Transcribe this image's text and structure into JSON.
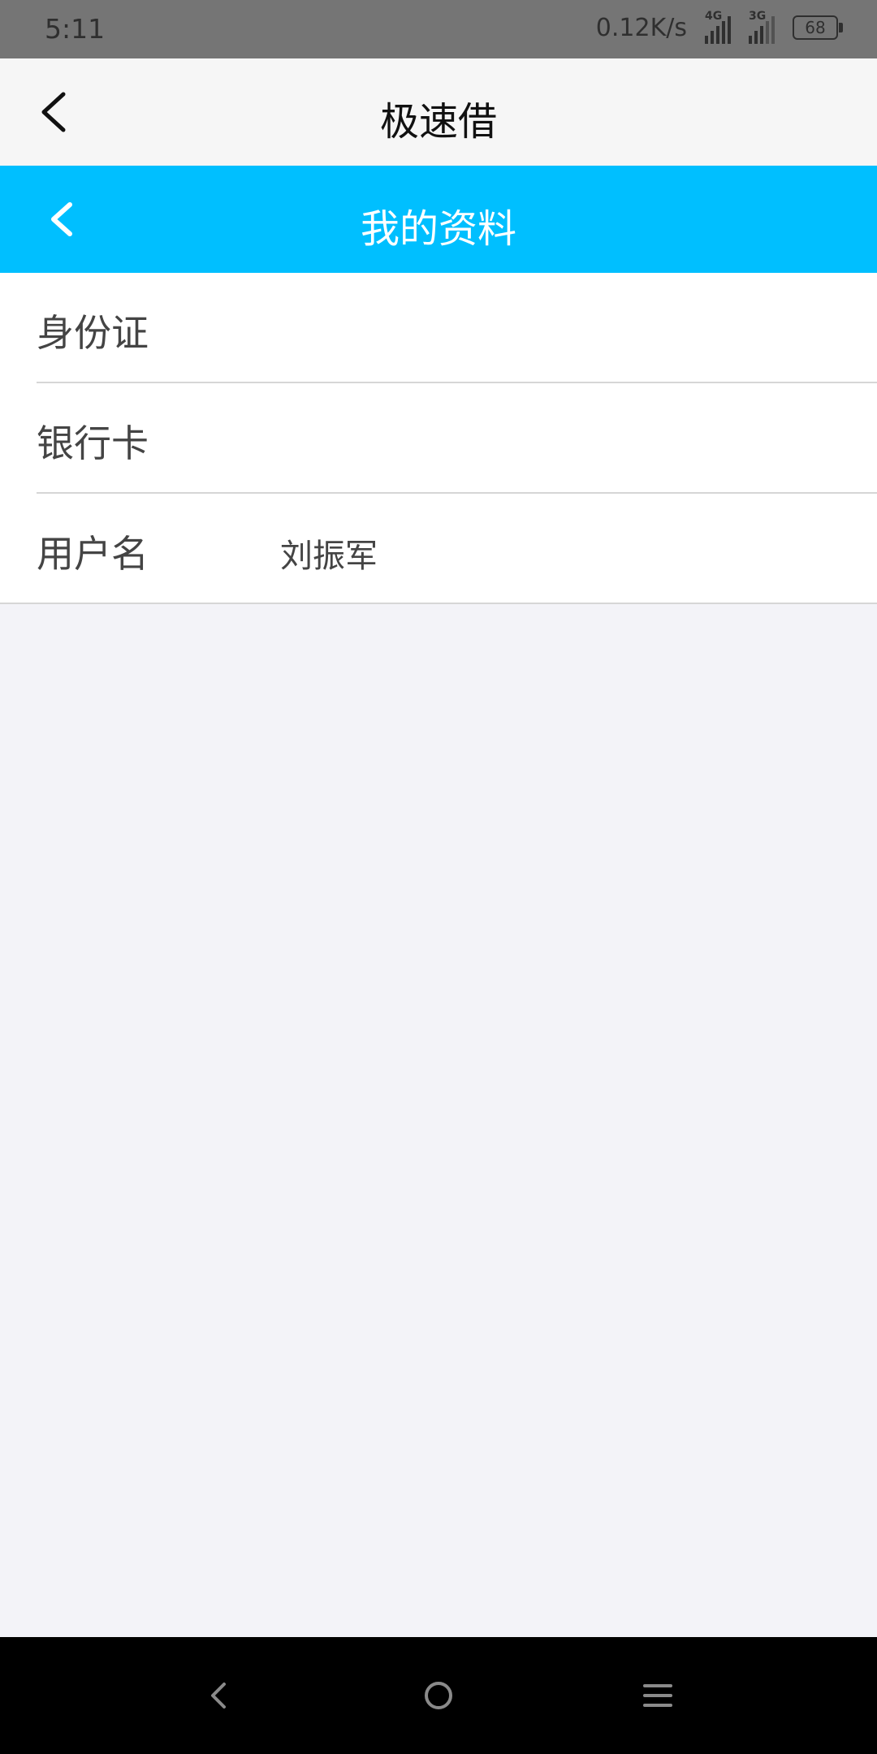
{
  "status_bar": {
    "time": "5:11",
    "net_speed": "0.12K/s",
    "signal1_label": "4G",
    "signal2_label": "3G",
    "battery": "68"
  },
  "app_bar": {
    "title": "极速借",
    "back_icon": "chevron-left-icon"
  },
  "sub_bar": {
    "title": "我的资料",
    "back_icon": "chevron-left-icon",
    "color": "#00bfff"
  },
  "profile": {
    "rows": [
      {
        "label": "身份证",
        "value": ""
      },
      {
        "label": "银行卡",
        "value": ""
      },
      {
        "label": "用户名",
        "value": "刘振军"
      }
    ]
  },
  "nav_bar": {
    "icons": [
      "back-triangle-icon",
      "home-circle-icon",
      "menu-lines-icon"
    ]
  }
}
